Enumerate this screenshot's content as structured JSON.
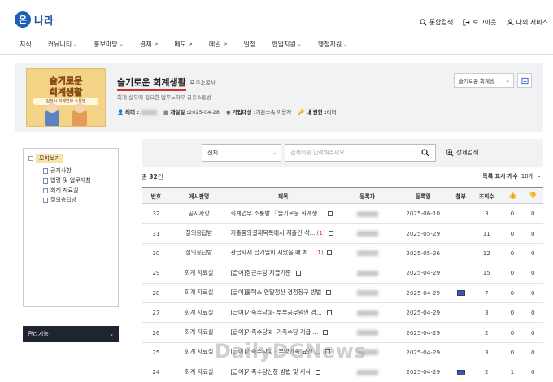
{
  "header": {
    "logo_mark": "온",
    "logo_text": "나라",
    "actions": [
      {
        "label": "통합검색",
        "icon": "search-icon"
      },
      {
        "label": "로그아웃",
        "icon": "logout-icon"
      },
      {
        "label": "나의 서비스",
        "icon": "user-icon"
      }
    ]
  },
  "nav": {
    "items": [
      {
        "label": "지식",
        "suffix": ""
      },
      {
        "label": "커뮤니티",
        "suffix": "⌄"
      },
      {
        "label": "홍보마당",
        "suffix": "⌄"
      },
      {
        "label": "결재",
        "suffix": "↗"
      },
      {
        "label": "메모",
        "suffix": "↗"
      },
      {
        "label": "메일",
        "suffix": "↗"
      },
      {
        "label": "일정",
        "suffix": ""
      },
      {
        "label": "협업지원",
        "suffix": "⌄"
      },
      {
        "label": "행정지원",
        "suffix": "⌄"
      }
    ]
  },
  "board": {
    "thumb_line1": "슬기로운",
    "thumb_line2": "회계생활",
    "thumb_line3": "김천시 회계업무 소통방",
    "title": "슬기로운 회계생활",
    "copy_label": "주소복사",
    "description": "회계 실무에 필요한 업무노하우 공유소통방",
    "leader_label": "리더 :",
    "opened_label": "개설일 :",
    "opened_value": "2025-04-28",
    "audience_label": "가입대상 :",
    "audience_value": "기관소속 이용자",
    "role_label": "내 권한 :",
    "role_value": "리더",
    "select_value": "슬기로운 회계생"
  },
  "sidebar": {
    "root": "모아보기",
    "items": [
      "공지사항",
      "법령 및 업무지침",
      "회계 자료실",
      "질의응답방"
    ],
    "admin_label": "관리기능",
    "admin_chevron": "⌄"
  },
  "search": {
    "select_value": "전체",
    "placeholder": "검색어를 입력해주세요.",
    "advanced_label": "상세검색"
  },
  "list": {
    "count_prefix": "총",
    "count": "32",
    "count_suffix": "건",
    "page_size_label": "목록 표시 개수",
    "page_size_value": "10개",
    "columns": [
      "번호",
      "게시판명",
      "제목",
      "등록자",
      "등록일",
      "첨부",
      "조회수",
      "👍",
      "👎"
    ],
    "rows": [
      {
        "no": "32",
        "board": "공지사항",
        "title": "회계업무 소통방 『슬기로운 회계생...",
        "comments": "",
        "date": "2025-06-10",
        "attach": false,
        "views": "3",
        "up": "0",
        "down": "0"
      },
      {
        "no": "31",
        "board": "질의응답방",
        "title": "지출품의결재목록에서 지출건 삭...",
        "comments": "(1)",
        "date": "2025-05-29",
        "attach": false,
        "views": "11",
        "up": "0",
        "down": "0"
      },
      {
        "no": "30",
        "board": "질의응답방",
        "title": "관급자재 납기일이 지났을 때 처...",
        "comments": "(1)",
        "date": "2025-05-26",
        "attach": false,
        "views": "12",
        "up": "0",
        "down": "0"
      },
      {
        "no": "29",
        "board": "회계 자료실",
        "title": "[급여]정근수당 지급기준",
        "comments": "",
        "date": "2025-04-29",
        "attach": false,
        "views": "15",
        "up": "0",
        "down": "0"
      },
      {
        "no": "28",
        "board": "회계 자료실",
        "title": "[급여]홈택스 연말정산 경정청구 방법",
        "comments": "",
        "date": "2025-04-29",
        "attach": true,
        "views": "7",
        "up": "0",
        "down": "0"
      },
      {
        "no": "27",
        "board": "회계 자료실",
        "title": "[급여]가족수당③- 부부공무원인 경...",
        "comments": "",
        "date": "2025-04-29",
        "attach": false,
        "views": "3",
        "up": "0",
        "down": "0"
      },
      {
        "no": "26",
        "board": "회계 자료실",
        "title": "[급여]가족수당②- 가족수당 지급 ...",
        "comments": "",
        "date": "2025-04-29",
        "attach": false,
        "views": "2",
        "up": "0",
        "down": "0"
      },
      {
        "no": "25",
        "board": "회계 자료실",
        "title": "[급여]가족수당① - 부양가족 요건 ...",
        "comments": "",
        "date": "2025-04-29",
        "attach": false,
        "views": "3",
        "up": "0",
        "down": "0"
      },
      {
        "no": "24",
        "board": "회계 자료실",
        "title": "[급여]가족수당신청 방법 및 서식",
        "comments": "",
        "date": "2025-04-29",
        "attach": true,
        "views": "2",
        "up": "1",
        "down": "0"
      }
    ]
  },
  "watermark": "DailyDGNews"
}
